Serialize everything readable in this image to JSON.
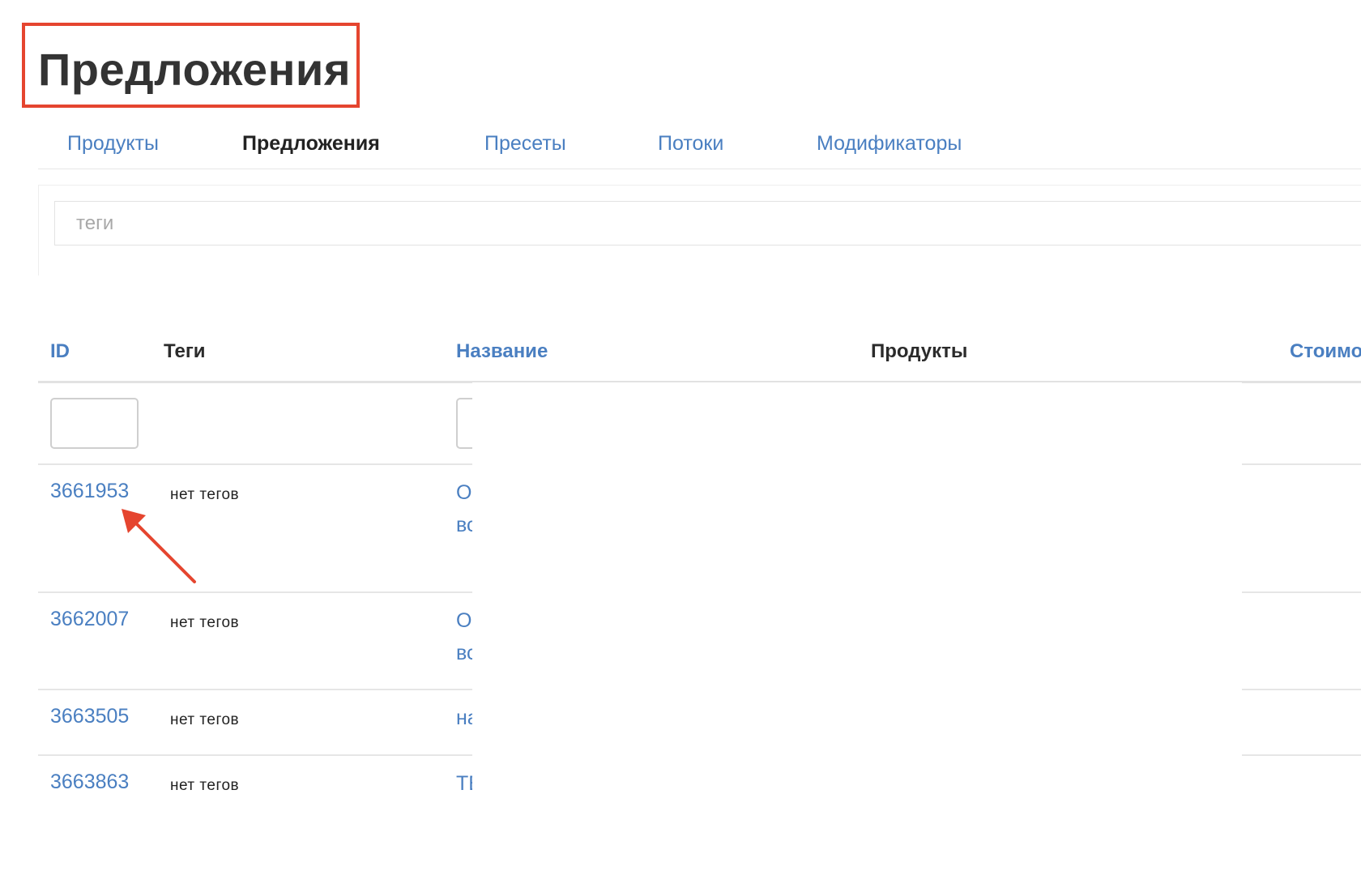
{
  "page": {
    "title": "Предложения"
  },
  "tabs": [
    {
      "label": "Продукты",
      "active": false
    },
    {
      "label": "Предложения",
      "active": true
    },
    {
      "label": "Пресеты",
      "active": false
    },
    {
      "label": "Потоки",
      "active": false
    },
    {
      "label": "Модификаторы",
      "active": false
    }
  ],
  "filter": {
    "tags_placeholder": "теги",
    "tags_value": ""
  },
  "table": {
    "columns": {
      "id": "ID",
      "tags": "Теги",
      "name": "Название",
      "products": "Продукты",
      "cost": "Стоимо"
    },
    "rows": [
      {
        "id": "3661953",
        "tags": "нет тегов",
        "name_line1": "О",
        "name_line2": "вс"
      },
      {
        "id": "3662007",
        "tags": "нет тегов",
        "name_line1": "О",
        "name_line2": "вс"
      },
      {
        "id": "3663505",
        "tags": "нет тегов",
        "name_line1": "на",
        "name_line2": ""
      },
      {
        "id": "3663863",
        "tags": "нет тегов",
        "name_line1": "ТЕ",
        "name_line2": ""
      }
    ]
  },
  "annotation": {
    "color": "#e5452f"
  },
  "colors": {
    "link": "#4a7fc1",
    "text": "#333333",
    "border": "#e2e2e2"
  }
}
